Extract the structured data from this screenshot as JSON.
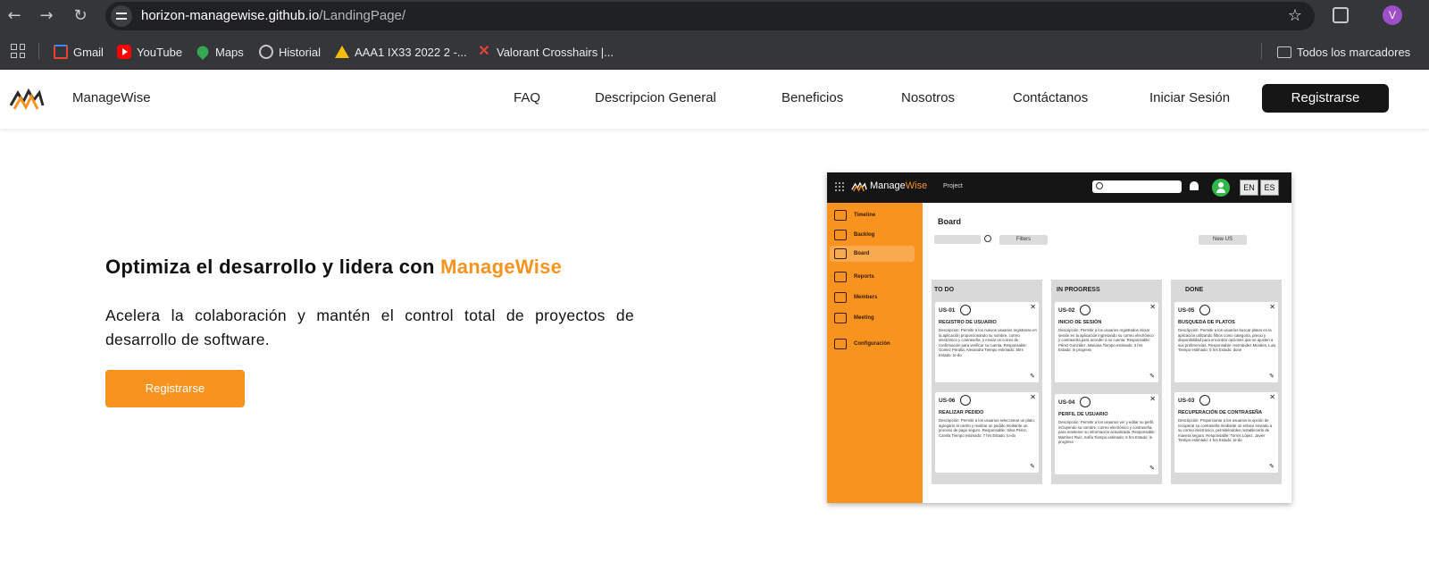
{
  "browser": {
    "url_host": "horizon-managewise.github.io",
    "url_path": "/LandingPage/",
    "profile_initial": "V",
    "bookmarks": [
      {
        "label": "Gmail",
        "icon": "gmail-icon"
      },
      {
        "label": "YouTube",
        "icon": "youtube-icon"
      },
      {
        "label": "Maps",
        "icon": "maps-icon"
      },
      {
        "label": "Historial",
        "icon": "history-icon"
      },
      {
        "label": "AAA1 IX33 2022 2 -...",
        "icon": "drive-icon"
      },
      {
        "label": "Valorant Crosshairs |...",
        "icon": "valorant-icon"
      }
    ],
    "all_bookmarks_label": "Todos los marcadores"
  },
  "header": {
    "brand": "ManageWise",
    "nav": [
      "FAQ",
      "Descripcion General",
      "Beneficios",
      "Nosotros",
      "Contáctanos",
      "Iniciar Sesión"
    ],
    "register_label": "Registrarse"
  },
  "hero": {
    "title_prefix": "Optimiza el desarrollo y lidera con ",
    "title_accent": "ManageWise",
    "subtitle": "Acelera la colaboración y mantén el control total de proyectos de desarrollo de software.",
    "cta_label": "Registrarse"
  },
  "colors": {
    "accent": "#f7931e",
    "dark": "#161616"
  },
  "preview": {
    "brand_manage": "Manage",
    "brand_wise": "Wise",
    "project_label": "Project",
    "lang_en": "EN",
    "lang_es": "ES",
    "sidebar": [
      "Timeline",
      "Backlog",
      "Board",
      "Reports",
      "Members",
      "Meeting",
      "Configuración"
    ],
    "board_title": "Board",
    "filters_label": "Filters",
    "new_us_label": "New US",
    "columns": [
      {
        "title": "TO DO",
        "cards": [
          {
            "id": "US-01",
            "title": "REGISTRO DE USUARIO",
            "body": "Descripcion: Permitir a los nuevos usuarios registrarse en la aplicación proporcionando su nombre, correo electrónico y contraseña, y enviar un correo de confirmación para verificar su cuenta. Responsable: Gomez Peralta, Alexandra Tiempo estimado: 5hrs Estado: to-do"
          },
          {
            "id": "US-06",
            "title": "REALIZAR PEDIDO",
            "body": "Descripción: Permitir a los usuarios seleccionar un plato, agregarlo al carrito y realizar un pedido mediante un proceso de pago seguro. Responsable: Silva Pérez, Camila Tiempo estimado: 7 hrs Estado: to-do"
          }
        ]
      },
      {
        "title": "IN PROGRESS",
        "cards": [
          {
            "id": "US-02",
            "title": "INICIO DE SESIÓN",
            "body": "Descripción: Permitir a los usuarios registrados iniciar sesión en la aplicación ingresando su correo electrónico y contraseña para acceder a su cuenta. Responsable: Pérez González, Mariana Tiempo estimado: 3 hrs Estado: in progress"
          },
          {
            "id": "US-04",
            "title": "PERFIL DE USUARIO",
            "body": "Descripción: Permitir a los usuarios ver y editar su perfil, incluyendo su nombre, correo electrónico y contraseña, para mantener su información actualizada. Responsable: Martínez Ruiz, Sofía Tiempo estimado: 6 hrs Estado: in progress"
          }
        ]
      },
      {
        "title": "DONE",
        "cards": [
          {
            "id": "US-05",
            "title": "BUSQUEDA DE PLATOS",
            "body": "Descripción: Permitir a los usuarios buscar platos en la aplicación utilizando filtros como categoría, precio y disponibilidad para encontrar opciones que se ajusten a sus preferencias. Responsable: Hernández Morales, Luis Tiempo estimado: 5 hrs Estado: done"
          },
          {
            "id": "US-03",
            "title": "RECUPERACIÓN DE CONTRASEÑA",
            "body": "Descripción: Proporcionar a los usuarios la opción de recuperar su contraseña mediante un enlace enviado a su correo electrónico, permitiéndoles restablecerla de manera segura. Responsable: Torres López, Javier Tiempo estimado: 4 hrs Estado: to-do"
          }
        ]
      }
    ]
  }
}
